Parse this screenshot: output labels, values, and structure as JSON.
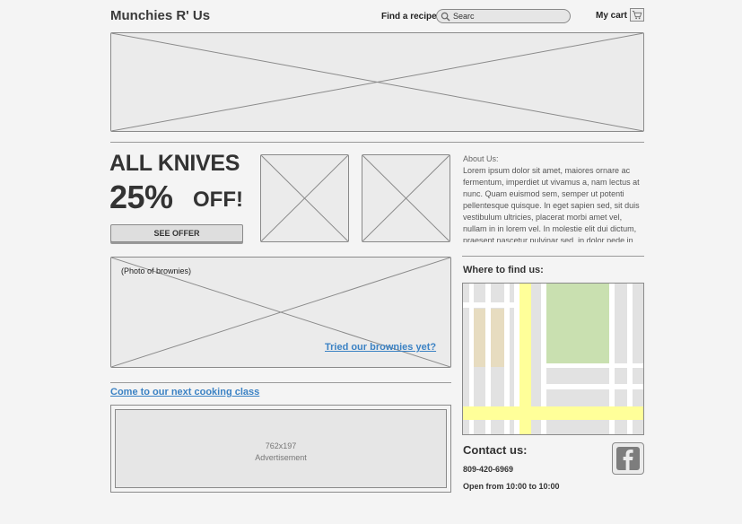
{
  "header": {
    "logo": "Munchies R' Us",
    "find_recipe_label": "Find a recipe",
    "search_value": "Searc",
    "cart_label": "My cart"
  },
  "promo": {
    "line1": "ALL KNIVES",
    "percent": "25%",
    "off": "OFF!",
    "button": "SEE OFFER"
  },
  "about": {
    "title": "About Us:",
    "text": "Lorem ipsum dolor sit amet, maiores ornare ac fermentum, imperdiet ut vivamus a, nam lectus at nunc. Quam euismod sem, semper ut potenti pellentesque quisque. In eget sapien sed, sit duis vestibulum ultricies, placerat morbi amet vel, nullam in in lorem vel. In molestie elit dui dictum, praesent nascetur pulvinar sed, in dolor pede in"
  },
  "brownies": {
    "caption": "(Photo of brownies)",
    "link": "Tried our brownies yet?"
  },
  "cooking_class": {
    "link": "Come to our next cooking class"
  },
  "ad": {
    "size": "762x197",
    "label": "Advertisement"
  },
  "location": {
    "title": "Where to find us:"
  },
  "contact": {
    "title": "Contact us:",
    "phone": "809-420-6969",
    "hours": "Open from 10:00 to 10:00"
  },
  "icons": {
    "search": "search-icon",
    "cart": "cart-icon",
    "facebook": "facebook-icon"
  },
  "colors": {
    "link": "#3b82c4",
    "map_park": "#c9e0b0",
    "map_main_road": "#ffff99",
    "map_buildings": "#e7dcc0"
  }
}
